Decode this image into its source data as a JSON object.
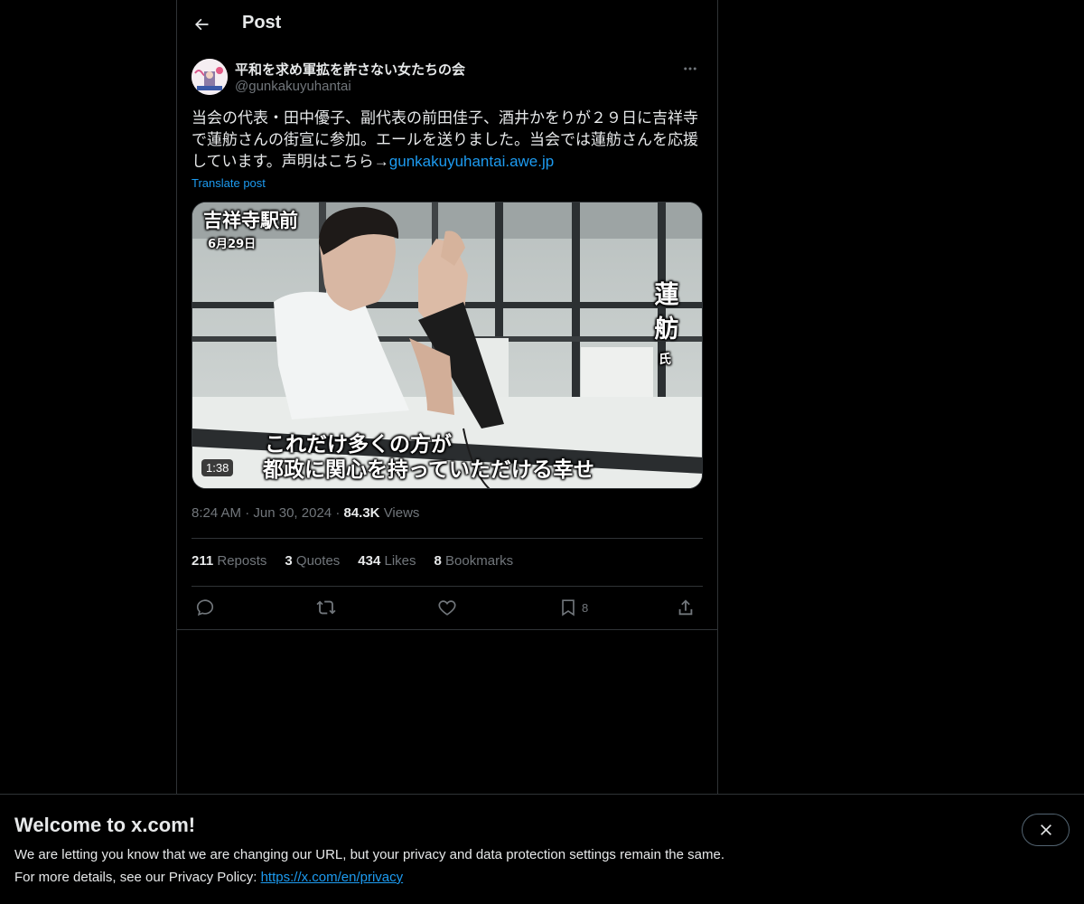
{
  "header": {
    "title": "Post"
  },
  "author": {
    "display_name": "平和を求め軍拡を許さない女たちの会",
    "handle": "@gunkakuyuhantai"
  },
  "post": {
    "text": "当会の代表・田中優子、副代表の前田佳子、酒井かをりが２９日に吉祥寺で蓮舫さんの街宣に参加。エールを送りました。当会では蓮舫さんを応援しています。声明はこちら→",
    "link": "gunkakuyuhantai.awe.jp",
    "translate_label": "Translate post"
  },
  "media": {
    "caption_location": "吉祥寺駅前",
    "caption_date": "6月29日",
    "caption_name": "蓮舫",
    "caption_honorific": "氏",
    "subtitle_line1": "これだけ多くの方が",
    "subtitle_line2": "都政に関心を持っていただける幸せ",
    "duration": "1:38"
  },
  "meta": {
    "time": "8:24 AM",
    "sep": "·",
    "date": "Jun 30, 2024",
    "views_count": "84.3K",
    "views_label": "Views"
  },
  "stats": {
    "reposts_count": "211",
    "reposts_label": "Reposts",
    "quotes_count": "3",
    "quotes_label": "Quotes",
    "likes_count": "434",
    "likes_label": "Likes",
    "bookmarks_count": "8",
    "bookmarks_label": "Bookmarks"
  },
  "actions": {
    "bookmark_count": "8"
  },
  "banner": {
    "title": "Welcome to x.com!",
    "line1": "We are letting you know that we are changing our URL, but your privacy and data protection settings remain the same.",
    "line2_prefix": "For more details, see our Privacy Policy: ",
    "privacy_link": "https://x.com/en/privacy"
  },
  "colors": {
    "accent": "#1d9bf0",
    "background": "#000000",
    "border": "#2f3336",
    "muted": "#71767b"
  }
}
